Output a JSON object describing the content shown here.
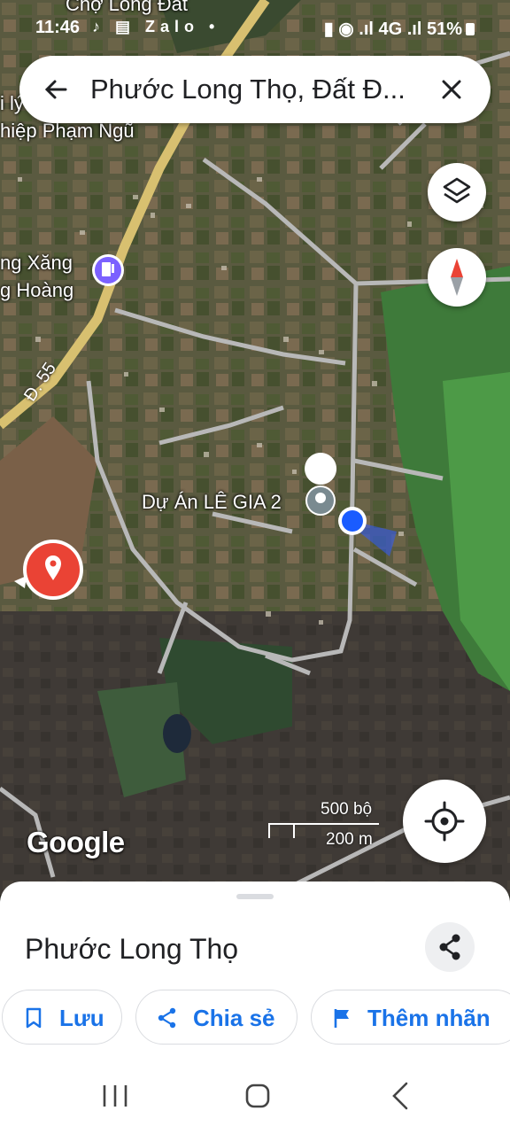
{
  "status_bar": {
    "time": "11:46",
    "notif_icons": "♪ ▤ Zalo •",
    "right_text": "▮ ◉ .ıl 4G .ıl 51%"
  },
  "search": {
    "query": "Phước Long Thọ, Đất Đ..."
  },
  "map": {
    "labels": {
      "cho": "Chợ Long Đất",
      "nghiep": "hiệp Phạm Ngũ",
      "iy": "i lý",
      "xang1": "ng Xăng",
      "xang2": "g Hoàng",
      "road": "Đ. 55",
      "project": "Dự Án LÊ GIA 2"
    },
    "google_logo": "Google",
    "scale_top": "500 bộ",
    "scale_bottom": "200 m"
  },
  "sheet": {
    "place_name": "Phước Long Thọ",
    "chips": {
      "save": "Lưu",
      "share": "Chia sẻ",
      "label": "Thêm nhãn"
    }
  },
  "colors": {
    "accent": "#1a73e8",
    "pin_red": "#ea4335",
    "location_blue": "#1a73e8"
  },
  "icons": [
    "back-arrow-icon",
    "close-icon",
    "layers-icon",
    "compass-icon",
    "locate-icon",
    "share-icon",
    "bookmark-icon",
    "flag-icon",
    "recents-icon",
    "home-icon",
    "back-icon"
  ]
}
